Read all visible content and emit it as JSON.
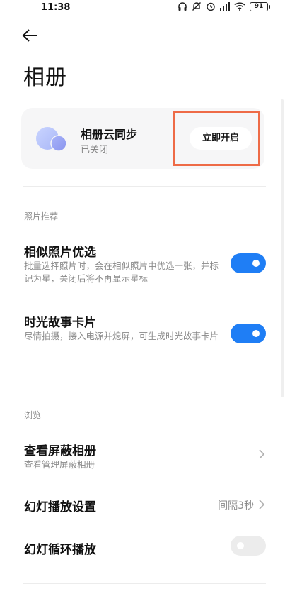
{
  "status_bar": {
    "time": "11:38",
    "battery": "91"
  },
  "header": {
    "title": "相册"
  },
  "cloud_sync": {
    "title": "相册云同步",
    "status": "已关闭",
    "button_label": "立即开启"
  },
  "sections": {
    "photo_recommend": {
      "label": "照片推荐",
      "similar": {
        "title": "相似照片优选",
        "desc": "批量选择照片时，会在相似照片中优选一张，并标记为星，关闭后将不再显示星标",
        "enabled": true
      },
      "story": {
        "title": "时光故事卡片",
        "desc": "尽情拍摄，接入电源并熄屏，可生成时光故事卡片",
        "enabled": true
      }
    },
    "browse": {
      "label": "浏览",
      "hidden_album": {
        "title": "查看屏蔽相册",
        "desc": "查看管理屏蔽相册"
      },
      "slideshow_settings": {
        "title": "幻灯播放设置",
        "value": "间隔3秒"
      },
      "slideshow_loop": {
        "title": "幻灯循环播放",
        "enabled": false
      }
    }
  },
  "colors": {
    "accent": "#1f7ef5",
    "highlight": "#ee6b47",
    "card_bg": "#f6f6f7"
  }
}
